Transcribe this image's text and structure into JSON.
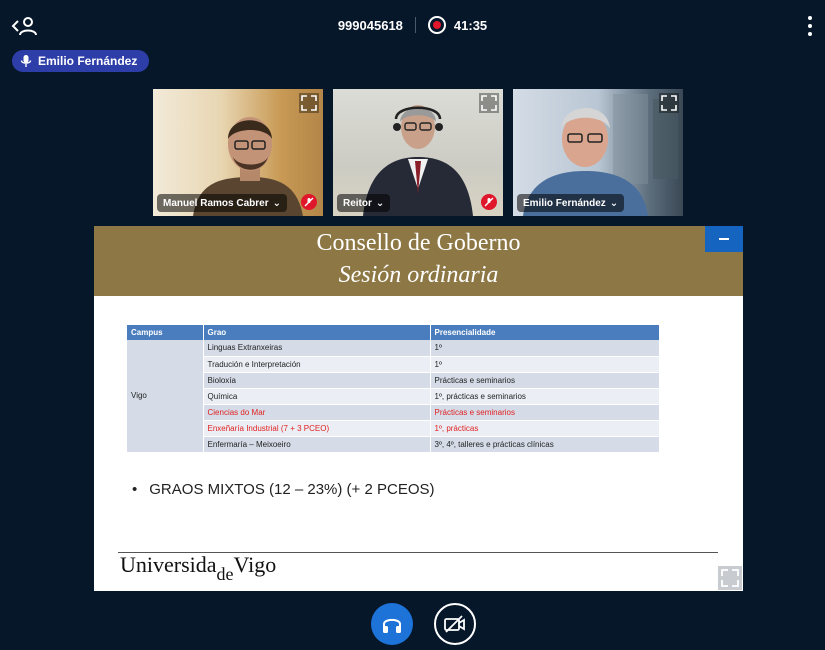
{
  "header": {
    "meeting_id": "999045618",
    "recording_time": "41:35"
  },
  "talker": {
    "name": "Emilio Fernández"
  },
  "videos": [
    {
      "name": "Manuel Ramos Cabrer",
      "muted": true
    },
    {
      "name": "Reitor",
      "muted": true
    },
    {
      "name": "Emilio Fernández",
      "muted": false
    }
  ],
  "slide": {
    "title": "Consello de Goberno",
    "subtitle": "Sesión ordinaria",
    "table": {
      "headers": [
        "Campus",
        "Grao",
        "Presencialidade"
      ],
      "campus": "Vigo",
      "rows": [
        {
          "grao": "Linguas Extranxeiras",
          "presencialidade": "1º",
          "highlight": false
        },
        {
          "grao": "Tradución e Interpretación",
          "presencialidade": "1º",
          "highlight": false
        },
        {
          "grao": "Bioloxía",
          "presencialidade": "Prácticas e seminarios",
          "highlight": false
        },
        {
          "grao": "Química",
          "presencialidade": "1º, prácticas e seminarios",
          "highlight": false
        },
        {
          "grao": "Ciencias do Mar",
          "presencialidade": "Prácticas e seminarios",
          "highlight": true
        },
        {
          "grao": "Enxeñaría Industrial (7 + 3 PCEO)",
          "presencialidade": "1º, prácticas",
          "highlight": true
        },
        {
          "grao": "Enfermaría – Meixoeiro",
          "presencialidade": "3º, 4º, talleres e prácticas clínicas",
          "highlight": false
        }
      ]
    },
    "bullet": "GRAOS MIXTOS (12 – 23%) (+ 2 PCEOS)",
    "logo": {
      "part1": "Universida",
      "part2": "de",
      "part3": "Vigo"
    }
  },
  "colors": {
    "background": "#06172a",
    "slide_header": "#8c7745",
    "table_header": "#4a7dbd",
    "highlight_text": "#e02020",
    "talker_pill": "#2e3ea8",
    "accent": "#1e73d8",
    "record": "#e0162b"
  },
  "icons": {
    "user_toggle": "users-icon",
    "record": "record-icon",
    "options": "vertical-dots-icon",
    "talker": "microphone-icon",
    "fullscreen": "expand-icon",
    "muted": "muted-microphone-icon",
    "audio": "headphones-icon",
    "video": "video-off-icon"
  }
}
